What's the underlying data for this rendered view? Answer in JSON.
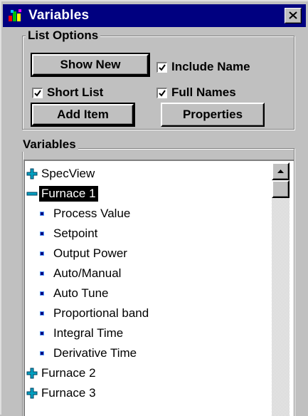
{
  "window": {
    "title": "Variables",
    "close_icon": "close-x"
  },
  "list_options": {
    "label": "List Options",
    "show_new_label": "Show New",
    "add_item_label": "Add Item",
    "properties_label": "Properties",
    "include_name": {
      "label": "Include Name",
      "checked": true
    },
    "short_list": {
      "label": "Short List",
      "checked": true
    },
    "full_names": {
      "label": "Full Names",
      "checked": true
    }
  },
  "variables_panel": {
    "label": "Variables",
    "tree": [
      {
        "label": "SpecView",
        "type": "collapsed"
      },
      {
        "label": "Furnace 1",
        "type": "expanded",
        "selected": true
      },
      {
        "label": "Process Value",
        "type": "leaf"
      },
      {
        "label": "Setpoint",
        "type": "leaf"
      },
      {
        "label": "Output Power",
        "type": "leaf"
      },
      {
        "label": "Auto/Manual",
        "type": "leaf"
      },
      {
        "label": "Auto Tune",
        "type": "leaf"
      },
      {
        "label": "Proportional band",
        "type": "leaf"
      },
      {
        "label": "Integral Time",
        "type": "leaf"
      },
      {
        "label": "Derivative Time",
        "type": "leaf"
      },
      {
        "label": "Furnace 2",
        "type": "collapsed"
      },
      {
        "label": "Furnace 3",
        "type": "collapsed"
      }
    ]
  },
  "colors": {
    "titlebar": "#000080",
    "face": "#c0c0c0",
    "expand_icon": "#00a0c0",
    "leaf_bullet": "#000080"
  }
}
